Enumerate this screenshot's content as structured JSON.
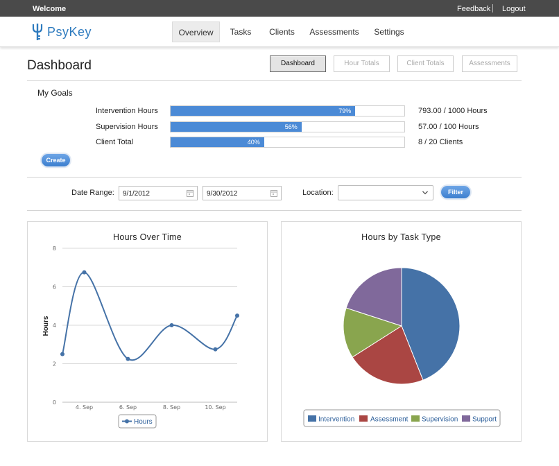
{
  "topbar": {
    "welcome": "Welcome",
    "feedback": "Feedback",
    "logout": "Logout"
  },
  "brand": {
    "name": "PsyKey",
    "color": "#2e7bbf"
  },
  "nav": [
    {
      "label": "Overview",
      "active": true
    },
    {
      "label": "Tasks"
    },
    {
      "label": "Clients"
    },
    {
      "label": "Assessments"
    },
    {
      "label": "Settings"
    }
  ],
  "page": {
    "title": "Dashboard"
  },
  "views": [
    {
      "label": "Dashboard",
      "active": true
    },
    {
      "label": "Hour Totals"
    },
    {
      "label": "Client Totals"
    },
    {
      "label": "Assessments"
    }
  ],
  "goals": {
    "title": "My Goals",
    "create_label": "Create",
    "items": [
      {
        "label": "Intervention Hours",
        "percent": 79,
        "percent_label": "79%",
        "value": "793.00 / 1000 Hours"
      },
      {
        "label": "Supervision Hours",
        "percent": 56,
        "percent_label": "56%",
        "value": "57.00 / 100 Hours"
      },
      {
        "label": "Client Total",
        "percent": 40,
        "percent_label": "40%",
        "value": "8 / 20 Clients"
      }
    ]
  },
  "filters": {
    "date_range_label": "Date Range:",
    "start_date": "9/1/2012",
    "end_date": "9/30/2012",
    "location_label": "Location:",
    "location_value": "",
    "filter_label": "Filter"
  },
  "colors": {
    "accent": "#4b8ad6",
    "line": "#4572a7"
  },
  "line_chart": {
    "title": "Hours Over Time",
    "ylabel": "Hours",
    "legend": "Hours",
    "y_ticks": [
      "0",
      "2",
      "4",
      "6",
      "8"
    ],
    "x_ticks": [
      "4. Sep",
      "6. Sep",
      "8. Sep",
      "10. Sep"
    ]
  },
  "pie_chart": {
    "title": "Hours by Task Type",
    "legend": [
      "Intervention",
      "Assessment",
      "Supervision",
      "Support"
    ]
  },
  "chart_data": [
    {
      "type": "line",
      "title": "Hours Over Time",
      "xlabel": "",
      "ylabel": "Hours",
      "x": [
        "3. Sep",
        "4. Sep",
        "6. Sep",
        "8. Sep",
        "10. Sep",
        "11. Sep"
      ],
      "x_days": [
        3,
        4,
        6,
        8,
        10,
        11
      ],
      "series": [
        {
          "name": "Hours",
          "values": [
            2.5,
            6.75,
            2.25,
            4.0,
            2.75,
            4.5
          ]
        }
      ],
      "ylim": [
        0,
        8
      ],
      "grid": true,
      "legend": "bottom-center"
    },
    {
      "type": "pie",
      "title": "Hours by Task Type",
      "categories": [
        "Intervention",
        "Assessment",
        "Supervision",
        "Support"
      ],
      "values": [
        44,
        22,
        14,
        20
      ],
      "colors": [
        "#4572a7",
        "#aa4643",
        "#89a54e",
        "#80699b"
      ],
      "legend": "bottom-center"
    }
  ]
}
